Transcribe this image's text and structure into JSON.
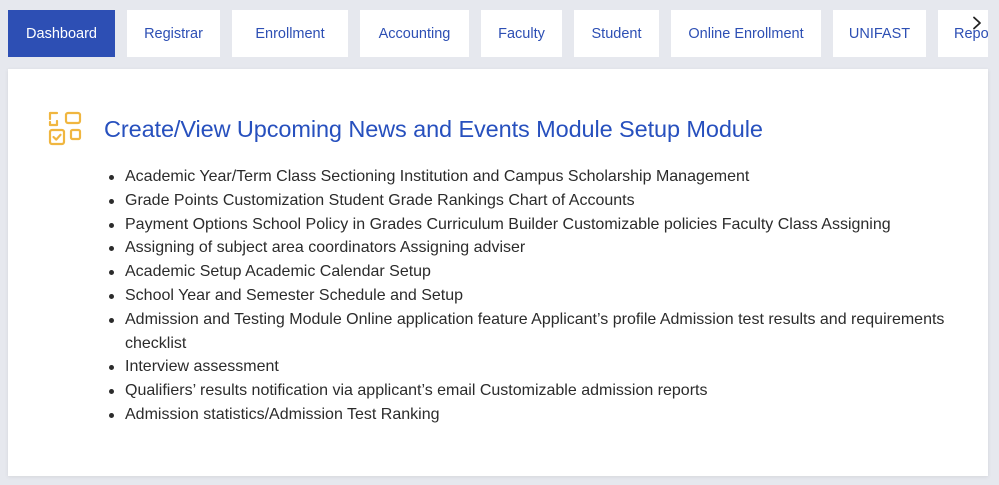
{
  "tabs": [
    {
      "label": "Dashboard",
      "active": true
    },
    {
      "label": "Registrar",
      "active": false
    },
    {
      "label": "Enrollment",
      "active": false
    },
    {
      "label": "Accounting",
      "active": false
    },
    {
      "label": "Faculty",
      "active": false
    },
    {
      "label": "Student",
      "active": false
    },
    {
      "label": "Online Enrollment",
      "active": false
    },
    {
      "label": "UNIFAST",
      "active": false
    },
    {
      "label": "Report",
      "active": false
    }
  ],
  "module": {
    "title": "Create/View Upcoming News and Events Module Setup Module",
    "icon": "apps-grid-check-icon",
    "features": [
      "Academic Year/Term Class Sectioning Institution and Campus Scholarship Management",
      "Grade Points Customization Student Grade Rankings Chart of Accounts",
      "Payment Options School Policy in Grades Curriculum Builder Customizable policies Faculty Class Assigning",
      "Assigning of subject area coordinators Assigning adviser",
      "Academic Setup Academic Calendar Setup",
      "School Year and Semester Schedule and Setup",
      "Admission and Testing Module Online application feature Applicant’s profile Admission test results and requirements checklist",
      "Interview assessment",
      "Qualifiers’ results notification via applicant’s email Customizable admission reports",
      "Admission statistics/Admission Test Ranking"
    ]
  },
  "colors": {
    "accent": "#2d4fb4",
    "icon": "#f0b640",
    "text": "#2b2b2b",
    "background": "#e6e8ee"
  }
}
